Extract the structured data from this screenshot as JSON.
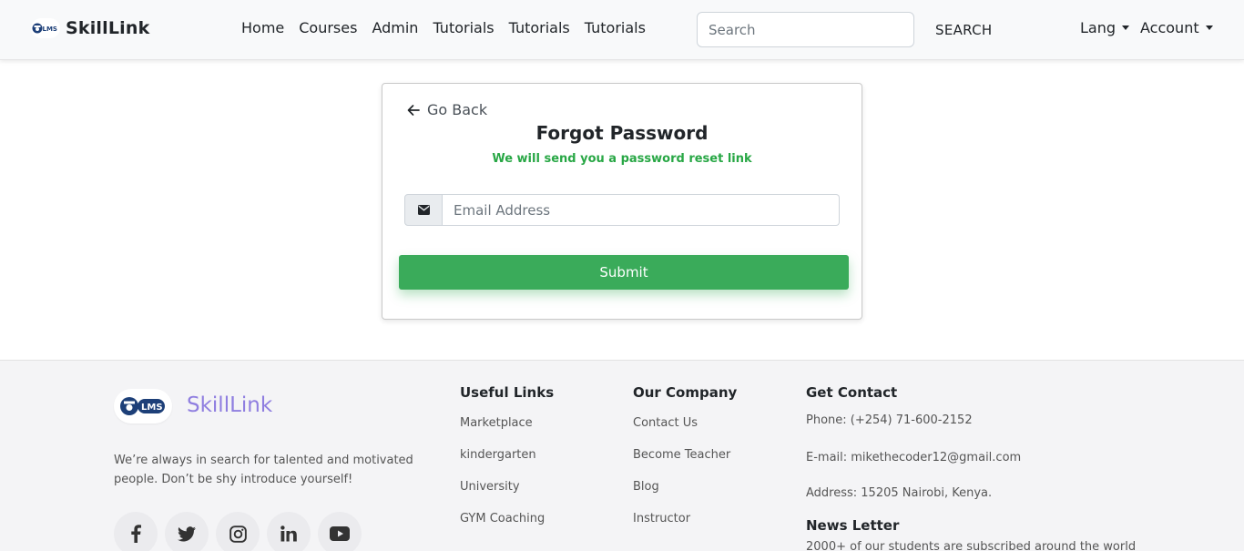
{
  "header": {
    "brand": "SkillLink",
    "logo_text": "LMS",
    "nav": [
      "Home",
      "Courses",
      "Admin",
      "Tutorials",
      "Tutorials",
      "Tutorials"
    ],
    "search_placeholder": "Search",
    "search_button": "SEARCH",
    "lang_label": "Lang",
    "account_label": "Account"
  },
  "card": {
    "back_label": "Go Back",
    "title": "Forgot Password",
    "subtitle": "We will send you a password reset link",
    "email_placeholder": "Email Address",
    "submit_label": "Submit"
  },
  "footer": {
    "brand": "SkillLink",
    "logo_text": "LMS",
    "description": "We’re always in search for talented and motivated people. Don’t be shy introduce yourself!",
    "socials": [
      "facebook-icon",
      "twitter-icon",
      "instagram-icon",
      "linkedin-icon",
      "youtube-icon"
    ],
    "useful_links": {
      "title": "Useful Links",
      "items": [
        "Marketplace",
        "kindergarten",
        "University",
        "GYM Coaching"
      ]
    },
    "company": {
      "title": "Our Company",
      "items": [
        "Contact Us",
        "Become Teacher",
        "Blog",
        "Instructor"
      ]
    },
    "contact": {
      "title": "Get Contact",
      "phone": "Phone: (+254) 71-600-2152",
      "email": "E-mail: mikethecoder12@gmail.com",
      "address": "Address: 15205 Nairobi, Kenya."
    },
    "newsletter": {
      "title": "News Letter",
      "text": "2000+ of our students are subscribed around the world"
    }
  },
  "colors": {
    "accent_green": "#3aab5a",
    "subtitle_green": "#28a745",
    "footer_brand": "#8f7ee0"
  }
}
